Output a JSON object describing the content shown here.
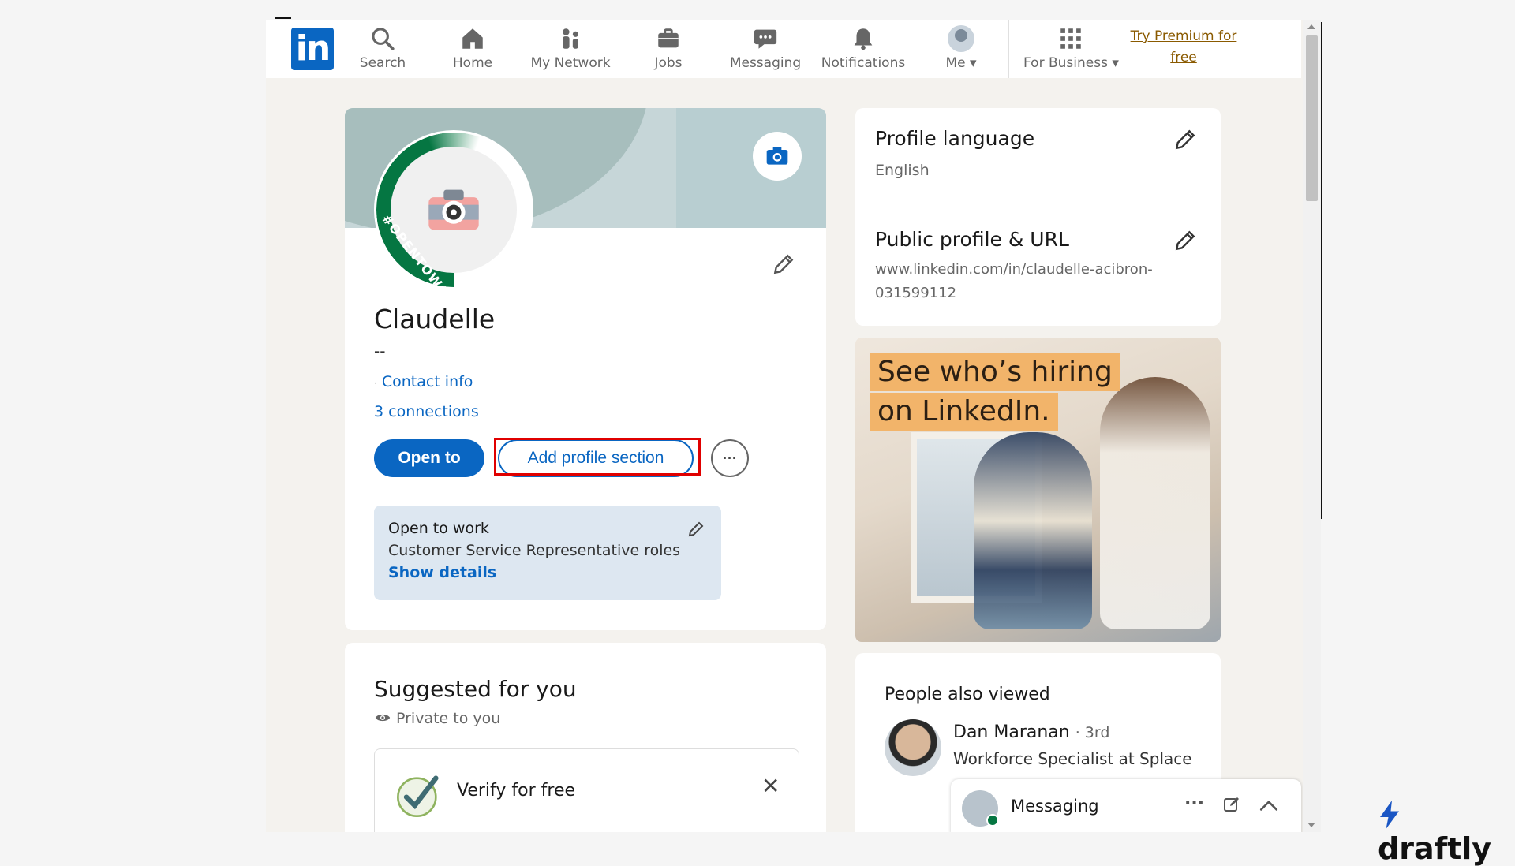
{
  "nav": {
    "logo": "in",
    "items": [
      {
        "label": "Search",
        "icon": "search-icon"
      },
      {
        "label": "Home",
        "icon": "home-icon"
      },
      {
        "label": "My Network",
        "icon": "network-icon"
      },
      {
        "label": "Jobs",
        "icon": "briefcase-icon"
      },
      {
        "label": "Messaging",
        "icon": "message-icon"
      },
      {
        "label": "Notifications",
        "icon": "bell-icon"
      },
      {
        "label": "Me",
        "icon": "avatar"
      },
      {
        "label": "For Business",
        "icon": "grid-icon"
      }
    ],
    "premium_line1": "Try Premium for",
    "premium_line2": "free"
  },
  "profile": {
    "badge_text": "#OPENTOWORK",
    "name": "Claudelle",
    "headline": "--",
    "contact_info": "Contact info",
    "connections": "3 connections",
    "btn_open_to": "Open to",
    "btn_add_section": "Add profile section",
    "btn_more": "···",
    "open_to_work": {
      "title": "Open to work",
      "roles": "Customer Service Representative roles",
      "link": "Show details"
    }
  },
  "suggested": {
    "title": "Suggested for you",
    "private": "Private to you",
    "verify_label": "Verify for free",
    "close": "✕"
  },
  "sidebar": {
    "profile_language": {
      "title": "Profile language",
      "value": "English"
    },
    "public_profile": {
      "title": "Public profile & URL",
      "line1": "www.linkedin.com/in/claudelle-acibron-",
      "line2": "031599112"
    }
  },
  "ad": {
    "line1": "See who’s hiring",
    "line2": "on LinkedIn."
  },
  "people_also_viewed": {
    "title": "People also viewed",
    "person": {
      "name": "Dan Maranan",
      "degree": "· 3rd",
      "role": "Workforce Specialist at Splace"
    }
  },
  "messaging": {
    "label": "Messaging",
    "dots": "···"
  },
  "watermark": "draftly",
  "colors": {
    "brand": "#0a66c2",
    "highlight": "#e00000",
    "open_to_work_green": "#057642"
  }
}
